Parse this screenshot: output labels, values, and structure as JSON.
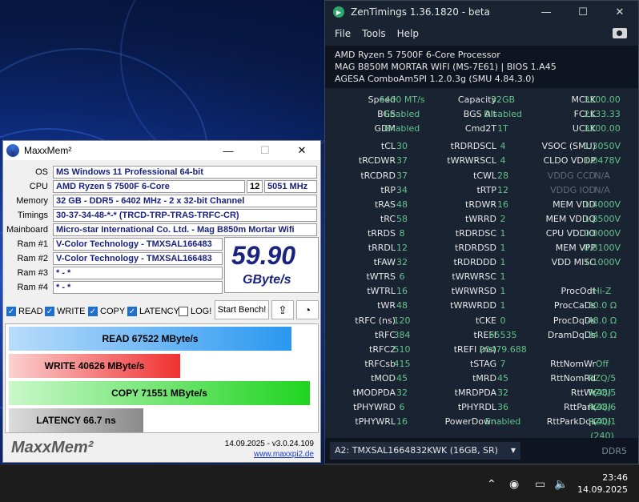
{
  "zen": {
    "title": "ZenTimings 1.36.1820 - beta",
    "menu": [
      "File",
      "Tools",
      "Help"
    ],
    "sysinfo": [
      "AMD Ryzen 5 7500F 6-Core Processor",
      "MAG B850M MORTAR WIFI (MS-7E61) | BIOS 1.A45",
      "AGESA ComboAm5PI 1.2.0.3g (SMU 4.84.3.0)"
    ],
    "col1": [
      [
        "Speed",
        "6400 MT/s"
      ],
      [
        "BGS",
        "Enabled"
      ],
      [
        "GDM",
        "Enabled"
      ],
      null,
      [
        "tCL",
        "30"
      ],
      [
        "tRCDWR",
        "37"
      ],
      [
        "tRCDRD",
        "37"
      ],
      [
        "tRP",
        "34"
      ],
      [
        "tRAS",
        "48"
      ],
      [
        "tRC",
        "58"
      ],
      [
        "tRRDS",
        "8"
      ],
      [
        "tRRDL",
        "12"
      ],
      [
        "tFAW",
        "32"
      ],
      [
        "tWTRS",
        "6"
      ],
      [
        "tWTRL",
        "16"
      ],
      [
        "tWR",
        "48"
      ],
      [
        "tRFC (ns)",
        "120"
      ],
      [
        "tRFC",
        "384"
      ],
      [
        "tRFC2",
        "510"
      ],
      [
        "tRFCsb",
        "415"
      ],
      [
        "tMOD",
        "45"
      ],
      [
        "tMODPDA",
        "32"
      ],
      [
        "tPHYWRD",
        "6"
      ],
      [
        "tPHYWRL",
        "16"
      ]
    ],
    "col2": [
      [
        "Capacity",
        "32GB"
      ],
      [
        "BGS Alt",
        "Disabled"
      ],
      [
        "Cmd2T",
        "1T"
      ],
      null,
      [
        "tRDRDSCL",
        "4"
      ],
      [
        "tWRWRSCL",
        "4"
      ],
      [
        "tCWL",
        "28"
      ],
      [
        "tRTP",
        "12"
      ],
      [
        "tRDWR",
        "16"
      ],
      [
        "tWRRD",
        "2"
      ],
      [
        "tRDRDSC",
        "1"
      ],
      [
        "tRDRDSD",
        "1"
      ],
      [
        "tRDRDDD",
        "1"
      ],
      [
        "tWRWRSC",
        "1"
      ],
      [
        "tWRWRSD",
        "1"
      ],
      [
        "tWRWRDD",
        "1"
      ],
      [
        "tCKE",
        "0"
      ],
      [
        "tREFI",
        "65535"
      ],
      [
        "tREFI (ns)",
        "20479.688"
      ],
      [
        "tSTAG",
        "7"
      ],
      [
        "tMRD",
        "45"
      ],
      [
        "tMRDPDA",
        "32"
      ],
      [
        "tPHYRDL",
        "36"
      ],
      [
        "PowerDown",
        "Enabled"
      ]
    ],
    "col3": [
      [
        "MCLK",
        "3200.00"
      ],
      [
        "FCLK",
        "2133.33"
      ],
      [
        "UCLK",
        "3200.00"
      ],
      null,
      [
        "VSOC (SMU)",
        "1.3050V"
      ],
      [
        "CLDO VDDP",
        "1.0478V"
      ],
      [
        "VDDG CCD",
        "N/A"
      ],
      [
        "VDDG IOD",
        "N/A"
      ],
      [
        "MEM VDD",
        "1.4000V"
      ],
      [
        "MEM VDDQ",
        "1.8500V"
      ],
      [
        "CPU VDDIO",
        "0.0000V"
      ],
      [
        "MEM VPP",
        "0.8100V"
      ],
      [
        "VDD MISC",
        "1.1000V"
      ],
      null,
      [
        "ProcOdt",
        "Hi-Z"
      ],
      [
        "ProcCaDs",
        "30.0 Ω"
      ],
      [
        "ProcDqDs",
        "48.0 Ω"
      ],
      [
        "DramDqDs",
        "34.0 Ω"
      ],
      null,
      [
        "RttNomWr",
        "Off"
      ],
      [
        "RttNomRd",
        "RZQ/5 (48)"
      ],
      [
        "RttWr",
        "RZQ/5 (48)"
      ],
      [
        "RttPark",
        "RZQ/6 (40)"
      ],
      [
        "RttParkDqs",
        "RZQ/1 (240)"
      ]
    ],
    "dim_labels": [
      "VDDG CCD",
      "VDDG IOD"
    ],
    "dropdown": "A2: TMXSAL1664832KWK (16GB, SR)",
    "ddr": "DDR5"
  },
  "mm": {
    "title": "MaxxMem²",
    "os_label": "OS",
    "os": "MS Windows 11 Professional 64-bit",
    "cpu_label": "CPU",
    "cpu": "AMD Ryzen 5 7500F 6-Core",
    "cores": "12",
    "clock": "5051 MHz",
    "memory_label": "Memory",
    "memory": "32 GB - DDR5 - 6402 MHz - 2 x 32-bit Channel",
    "timings_label": "Timings",
    "timings": "30-37-34-48-*-* (TRCD-TRP-TRAS-TRFC-CR)",
    "mainboard_label": "Mainboard",
    "mainboard": "Micro-star International Co. Ltd. - Mag B850m Mortar Wifi",
    "ram1_label": "Ram #1",
    "ram1": "V-Color Technology - TMXSAL166483",
    "ram2_label": "Ram #2",
    "ram2": "V-Color Technology - TMXSAL166483",
    "ram3_label": "Ram #3",
    "ram3": "* - *",
    "ram4_label": "Ram #4",
    "ram4": "* - *",
    "speed": "59.90",
    "speed_unit": "GByte/s",
    "chk_read": "READ",
    "chk_write": "WRITE",
    "chk_copy": "COPY",
    "chk_latency": "LATENCY",
    "chk_log": "LOG!",
    "start_bench": "Start Bench!",
    "read_text": "READ  67522  MByte/s",
    "read_fill": 0.925,
    "write_text": "WRITE  40626  MByte/s",
    "write_fill": 0.56,
    "copy_text": "COPY  71551  MByte/s",
    "copy_fill": 0.985,
    "latency_text": "LATENCY  66.7  ns",
    "latency_fill": 0.44,
    "brand": "MaxxMem²",
    "date": "14.09.2025 - v3.0.24.109",
    "url": "www.maxxpi2.de"
  },
  "taskbar": {
    "time": "23:46",
    "date": "14.09.2025"
  }
}
